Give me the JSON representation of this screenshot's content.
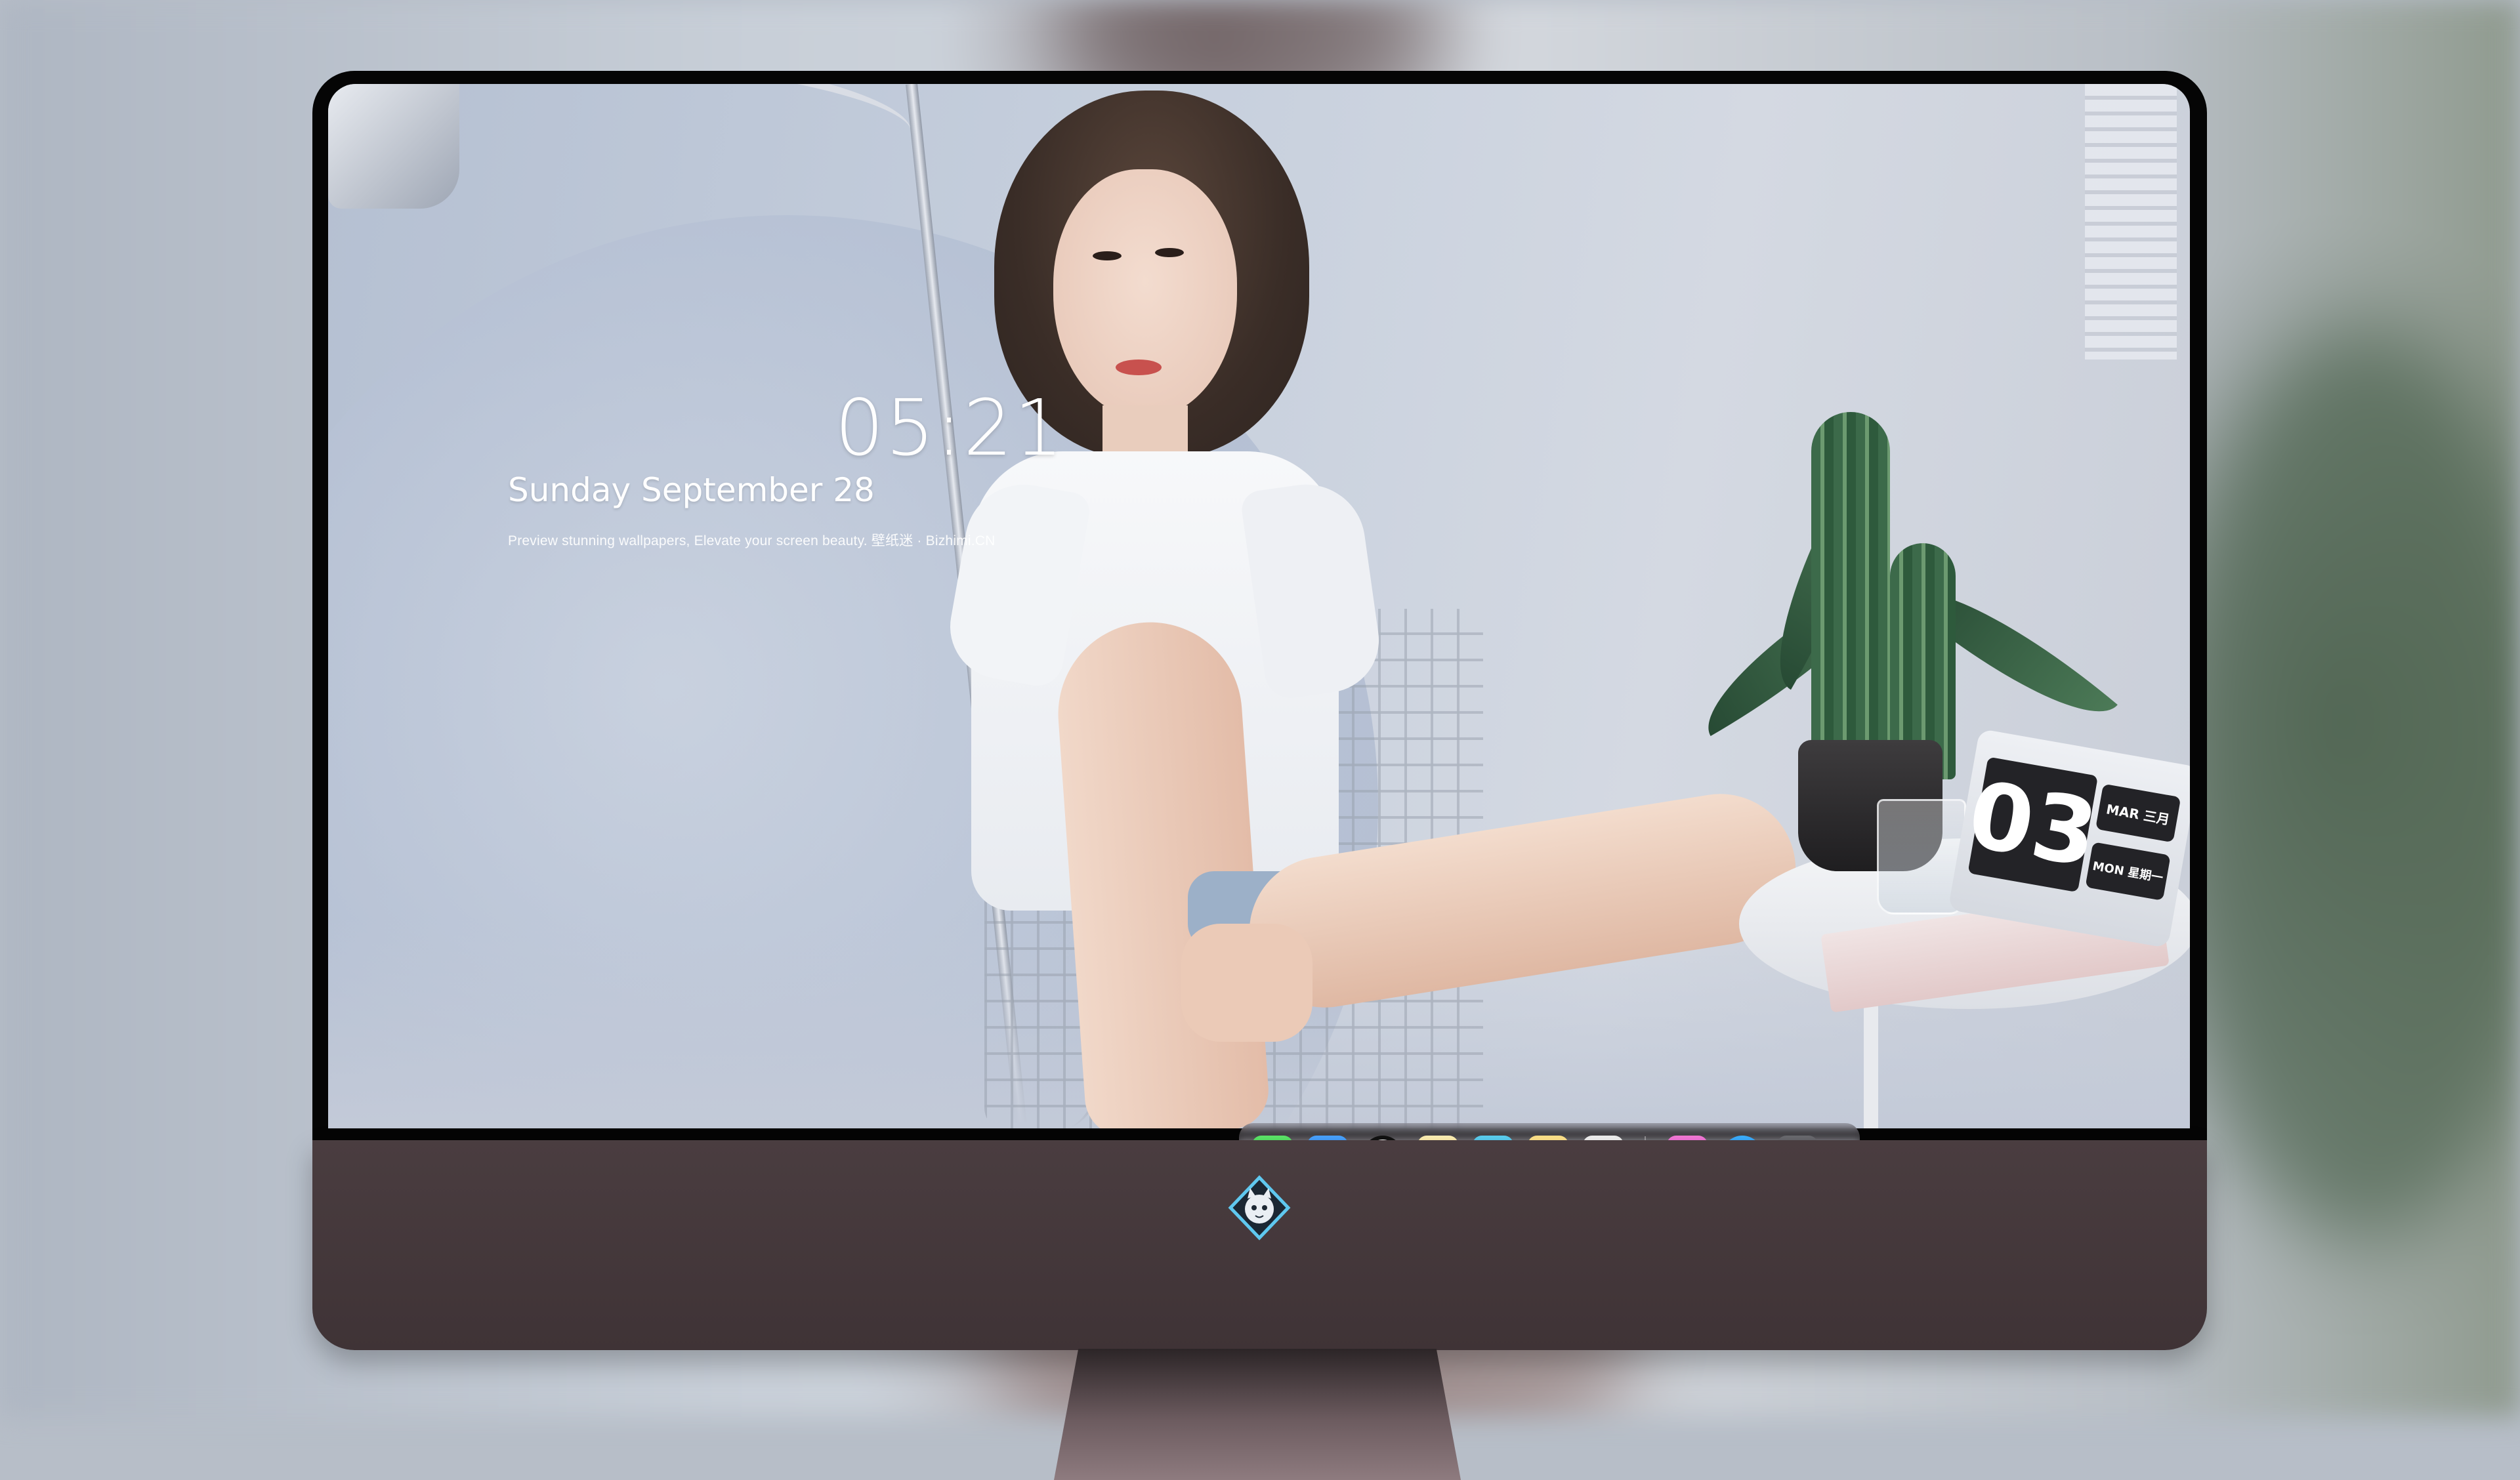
{
  "lockscreen": {
    "time": "05:21",
    "date": "Sunday September  28",
    "tagline": "Preview stunning wallpapers, Elevate your screen beauty. 壁纸迷 · Bizhimi.CN"
  },
  "calendar_prop": {
    "day": "03",
    "month": "MAR 三月",
    "weekday": "MON 星期一"
  },
  "dock": {
    "apps": [
      {
        "name": "Messages",
        "icon": "messages-icon",
        "color": "#2fcf4f"
      },
      {
        "name": "Weather",
        "icon": "weather-icon",
        "color": "#3a8ef0"
      },
      {
        "name": "Clock",
        "icon": "clock-icon",
        "color": "#111111"
      },
      {
        "name": "Preview",
        "icon": "preview-icon",
        "color": "#f2c94c"
      },
      {
        "name": "Clips",
        "icon": "clips-icon",
        "color": "#39b6e6"
      },
      {
        "name": "Notes",
        "icon": "notes-icon",
        "color": "#f7d24b"
      },
      {
        "name": "Photo Booth",
        "icon": "photo-booth-icon",
        "color": "#e8e8e8"
      },
      {
        "name": "iTunes",
        "icon": "itunes-icon",
        "color": "#e94fd0"
      },
      {
        "name": "App Store",
        "icon": "app-store-icon",
        "color": "#1e8ff5"
      },
      {
        "name": "Camera",
        "icon": "camera-icon",
        "color": "#4a4a4e"
      }
    ]
  },
  "colors": {
    "monitor_chin": "#4a3d40",
    "bezel": "#050505",
    "dock_bg": "rgba(120,115,125,0.45)"
  }
}
